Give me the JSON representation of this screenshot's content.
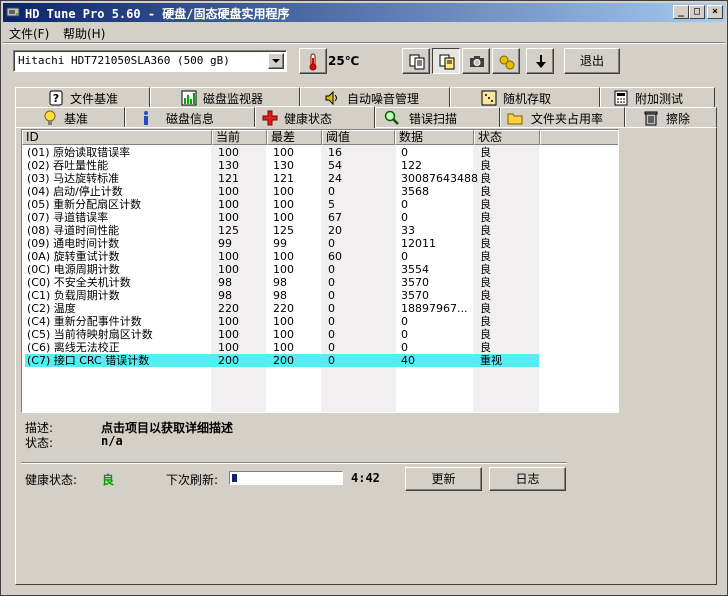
{
  "window": {
    "title": "HD Tune Pro 5.60 - 硬盘/固态硬盘实用程序"
  },
  "menu": {
    "file": "文件(F)",
    "help": "帮助(H)"
  },
  "toolbar": {
    "drive": "Hitachi HDT721050SLA360 (500 gB)",
    "temperature": "25℃",
    "exit_label": "退出"
  },
  "tabs_top": [
    "文件基准",
    "磁盘监视器",
    "自动噪音管理",
    "随机存取",
    "附加测试"
  ],
  "tabs_bottom": [
    "基准",
    "磁盘信息",
    "健康状态",
    "错误扫描",
    "文件夹占用率",
    "擦除"
  ],
  "active_tab": "健康状态",
  "table": {
    "headers": [
      "ID",
      "当前",
      "最差",
      "阈值",
      "数据",
      "状态"
    ],
    "rows": [
      [
        "(01) 原始读取错误率",
        "100",
        "100",
        "16",
        "0",
        "良"
      ],
      [
        "(02) 吞吐量性能",
        "130",
        "130",
        "54",
        "122",
        "良"
      ],
      [
        "(03) 马达旋转标准",
        "121",
        "121",
        "24",
        "30087643488",
        "良"
      ],
      [
        "(04) 启动/停止计数",
        "100",
        "100",
        "0",
        "3568",
        "良"
      ],
      [
        "(05) 重新分配扇区计数",
        "100",
        "100",
        "5",
        "0",
        "良"
      ],
      [
        "(07) 寻道错误率",
        "100",
        "100",
        "67",
        "0",
        "良"
      ],
      [
        "(08) 寻道时间性能",
        "125",
        "125",
        "20",
        "33",
        "良"
      ],
      [
        "(09) 通电时间计数",
        "99",
        "99",
        "0",
        "12011",
        "良"
      ],
      [
        "(0A) 旋转重试计数",
        "100",
        "100",
        "60",
        "0",
        "良"
      ],
      [
        "(0C) 电源周期计数",
        "100",
        "100",
        "0",
        "3554",
        "良"
      ],
      [
        "(C0) 不安全关机计数",
        "98",
        "98",
        "0",
        "3570",
        "良"
      ],
      [
        "(C1) 负载周期计数",
        "98",
        "98",
        "0",
        "3570",
        "良"
      ],
      [
        "(C2) 温度",
        "220",
        "220",
        "0",
        "18897967...",
        "良"
      ],
      [
        "(C4) 重新分配事件计数",
        "100",
        "100",
        "0",
        "0",
        "良"
      ],
      [
        "(C5) 当前待映射扇区计数",
        "100",
        "100",
        "0",
        "0",
        "良"
      ],
      [
        "(C6) 离线无法校正",
        "100",
        "100",
        "0",
        "0",
        "良"
      ],
      [
        "(C7) 接口 CRC 错误计数",
        "200",
        "200",
        "0",
        "40",
        "重视"
      ]
    ],
    "selected_row": 16
  },
  "details": {
    "desc_label": "描述:",
    "desc_value": "点击项目以获取详细描述",
    "status_label": "状态:",
    "status_value": "n/a"
  },
  "footer": {
    "health_label": "健康状态:",
    "health_value": "良",
    "health_color": "#00a000",
    "refresh_label": "下次刷新:",
    "refresh_progress_percent": 5,
    "countdown": "4:42",
    "update_label": "更新",
    "log_label": "日志"
  }
}
